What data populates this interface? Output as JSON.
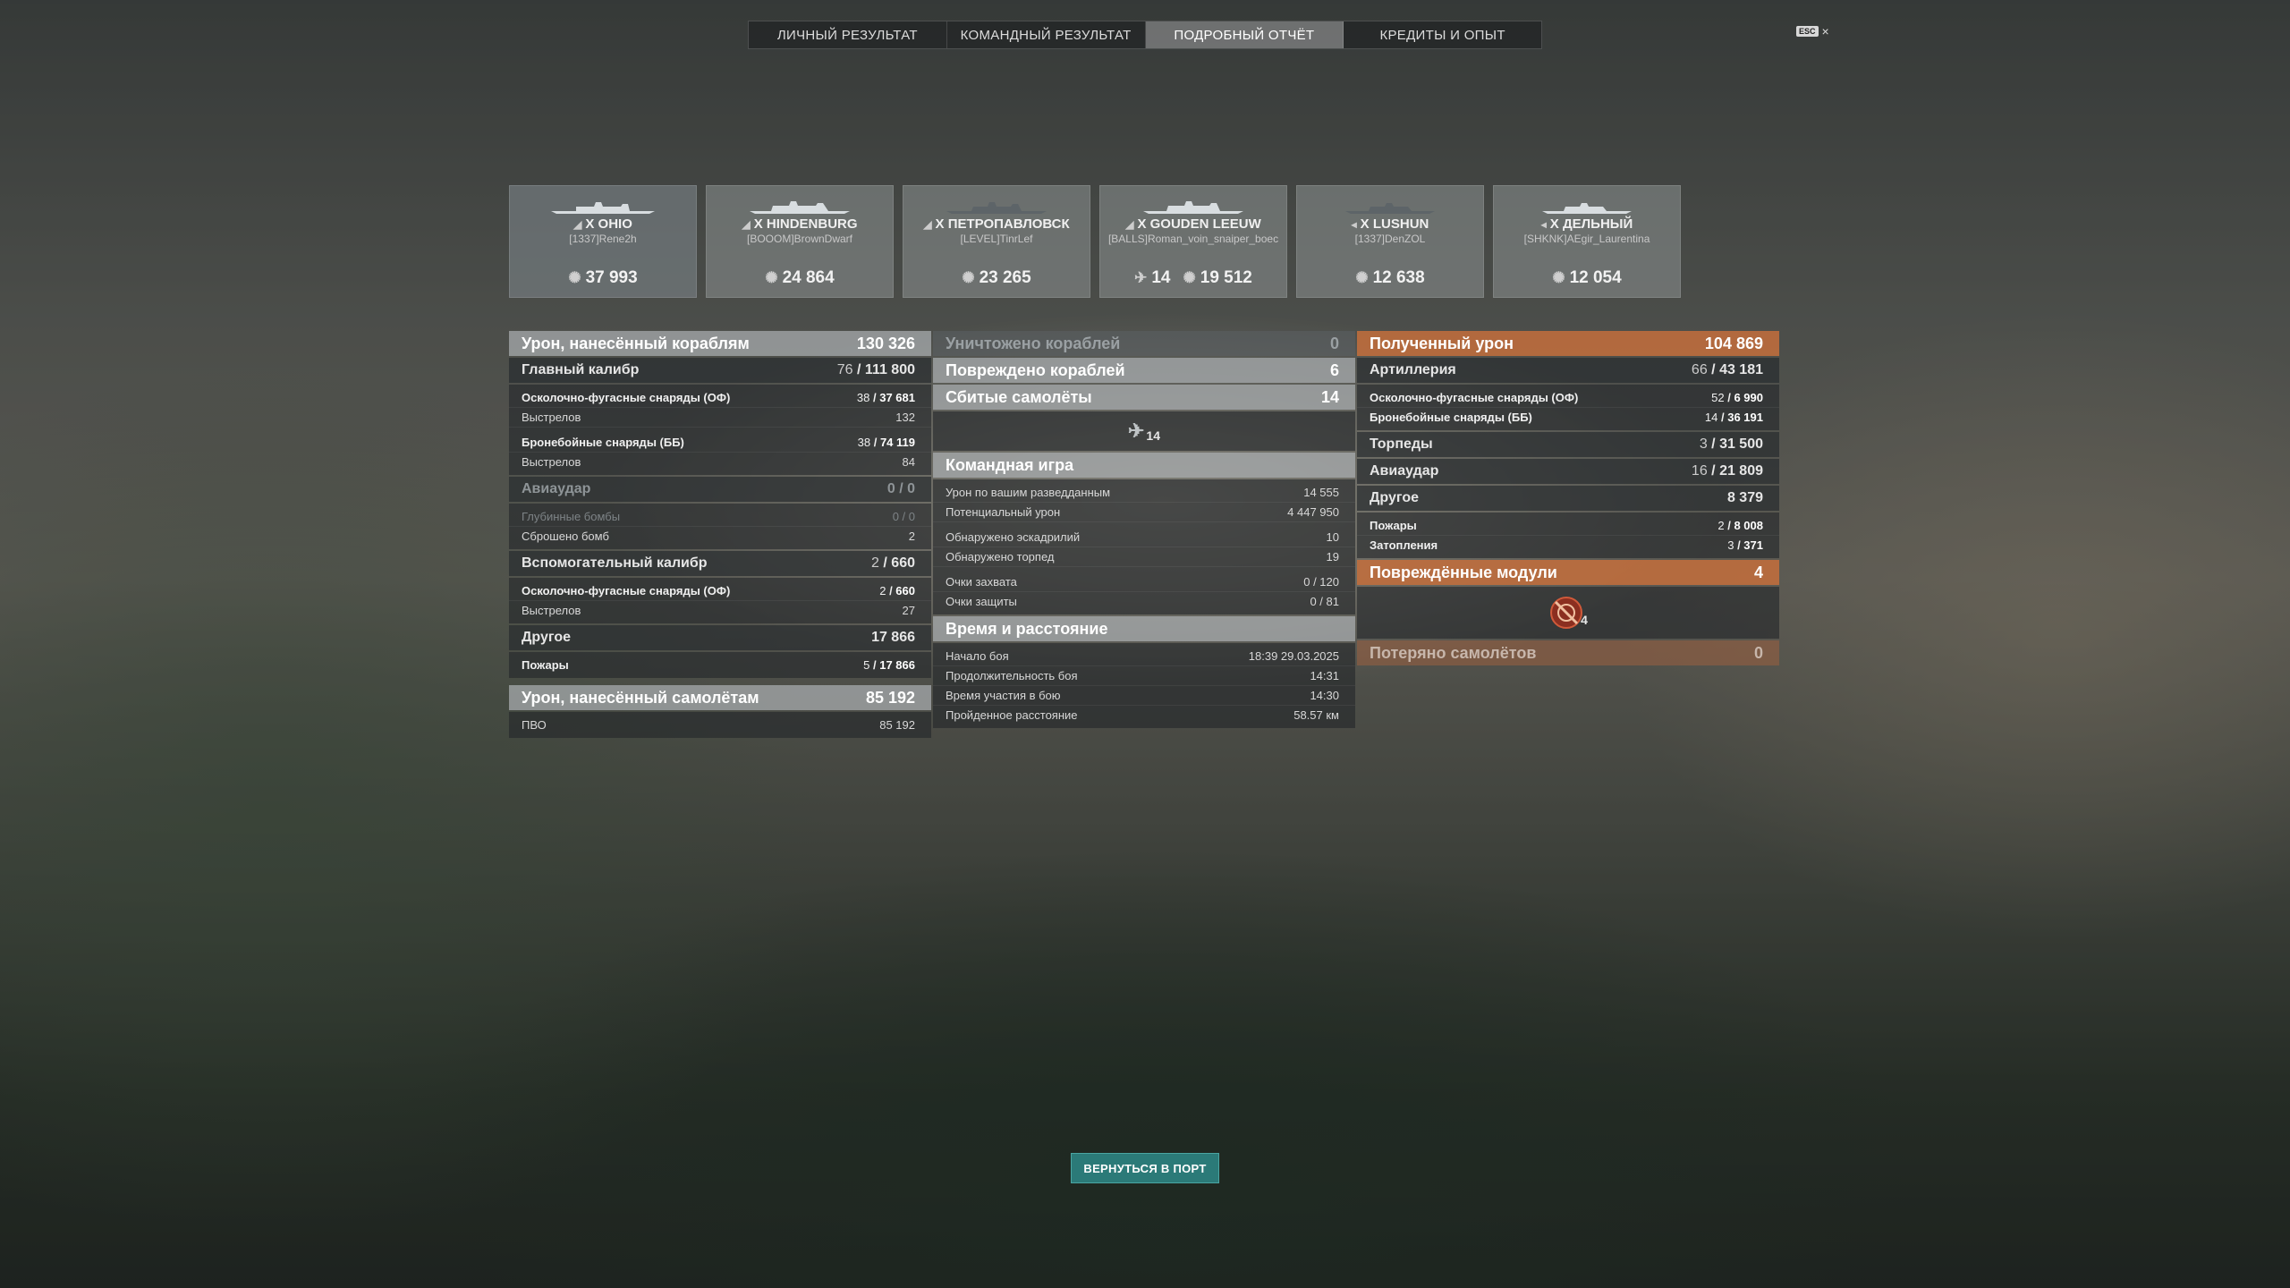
{
  "tabs": [
    "ЛИЧНЫЙ РЕЗУЛЬТАТ",
    "КОМАНДНЫЙ РЕЗУЛЬТАТ",
    "ПОДРОБНЫЙ ОТЧЁТ",
    "КРЕДИТЫ И ОПЫТ"
  ],
  "active_tab": "ПОДРОБНЫЙ ОТЧЁТ",
  "esc": {
    "key": "ESC",
    "close": "×"
  },
  "ships": [
    {
      "tier": "X",
      "name": "OHIO",
      "player": "[1337]Rene2h",
      "damage": "37 993"
    },
    {
      "tier": "X",
      "name": "HINDENBURG",
      "player": "[BOOOM]BrownDwarf",
      "damage": "24 864"
    },
    {
      "tier": "X",
      "name": "ПЕТРОПАВЛОВСК",
      "player": "[LEVEL]TinrLef",
      "damage": "23 265"
    },
    {
      "tier": "X",
      "name": "GOUDEN LEEUW",
      "player": "[BALLS]Roman_voin_snaiper_boec",
      "planes": "14",
      "damage": "19 512"
    },
    {
      "tier": "X",
      "name": "LUSHUN",
      "player": "[1337]DenZOL",
      "damage": "12 638"
    },
    {
      "tier": "X",
      "name": "ДЕЛЬНЫЙ",
      "player": "[SHKNK]AEgir_Laurentina",
      "damage": "12 054"
    }
  ],
  "col1": {
    "dmg_ships": {
      "label": "Урон, нанесённый кораблям",
      "value": "130 326"
    },
    "main": {
      "label": "Главный калибр",
      "hits": "76",
      "value": "111 800"
    },
    "he": {
      "label": "Осколочно-фугасные снаряды (ОФ)",
      "hits": "38",
      "value": "37 681"
    },
    "he_shots": {
      "label": "Выстрелов",
      "value": "132"
    },
    "ap": {
      "label": "Бронебойные снаряды (ББ)",
      "hits": "38",
      "value": "74 119"
    },
    "ap_shots": {
      "label": "Выстрелов",
      "value": "84"
    },
    "air": {
      "label": "Авиаудар",
      "value": "0 / 0"
    },
    "depth": {
      "label": "Глубинные бомбы",
      "value": "0 / 0"
    },
    "bombs": {
      "label": "Сброшено бомб",
      "value": "2"
    },
    "secondary": {
      "label": "Вспомогательный калибр",
      "hits": "2",
      "value": "660"
    },
    "sec_he": {
      "label": "Осколочно-фугасные снаряды (ОФ)",
      "hits": "2",
      "value": "660"
    },
    "sec_shots": {
      "label": "Выстрелов",
      "value": "27"
    },
    "other": {
      "label": "Другое",
      "value": "17 866"
    },
    "fires": {
      "label": "Пожары",
      "hits": "5",
      "value": "17 866"
    },
    "dmg_planes": {
      "label": "Урон, нанесённый самолётам",
      "value": "85 192"
    },
    "aa": {
      "label": "ПВО",
      "value": "85 192"
    }
  },
  "col2": {
    "destroyed": {
      "label": "Уничтожено кораблей",
      "value": "0"
    },
    "damaged": {
      "label": "Повреждено кораблей",
      "value": "6"
    },
    "planes": {
      "label": "Сбитые самолёты",
      "value": "14"
    },
    "planes_icon_count": "14",
    "team": {
      "label": "Командная игра"
    },
    "spotting": {
      "label": "Урон по вашим разведданным",
      "value": "14 555"
    },
    "potential": {
      "label": "Потенциальный урон",
      "value": "4 447 950"
    },
    "squadrons": {
      "label": "Обнаружено эскадрилий",
      "value": "10"
    },
    "torpedoes": {
      "label": "Обнаружено торпед",
      "value": "19"
    },
    "capture": {
      "label": "Очки захвата",
      "value": "0 / 120"
    },
    "defense": {
      "label": "Очки защиты",
      "value": "0 / 81"
    },
    "time": {
      "label": "Время и расстояние"
    },
    "start": {
      "label": "Начало боя",
      "value": "18:39  29.03.2025"
    },
    "duration": {
      "label": "Продолжительность боя",
      "value": "14:31"
    },
    "participation": {
      "label": "Время участия в бою",
      "value": "14:30"
    },
    "distance": {
      "label": "Пройденное расстояние",
      "value": "58.57 км"
    }
  },
  "col3": {
    "received": {
      "label": "Полученный урон",
      "value": "104 869"
    },
    "artillery": {
      "label": "Артиллерия",
      "hits": "66",
      "value": "43 181"
    },
    "r_he": {
      "label": "Осколочно-фугасные снаряды (ОФ)",
      "hits": "52",
      "value": "6 990"
    },
    "r_ap": {
      "label": "Бронебойные снаряды (ББ)",
      "hits": "14",
      "value": "36 191"
    },
    "torps": {
      "label": "Торпеды",
      "hits": "3",
      "value": "31 500"
    },
    "air": {
      "label": "Авиаудар",
      "hits": "16",
      "value": "21 809"
    },
    "other": {
      "label": "Другое",
      "value": "8 379"
    },
    "fires": {
      "label": "Пожары",
      "hits": "2",
      "value": "8 008"
    },
    "floods": {
      "label": "Затопления",
      "hits": "3",
      "value": "371"
    },
    "modules": {
      "label": "Повреждённые модули",
      "value": "4"
    },
    "modules_icon_count": "4",
    "lost_planes": {
      "label": "Потеряно самолётов",
      "value": "0"
    }
  },
  "return_button": "ВЕРНУТЬСЯ В ПОРТ",
  "colors": {
    "accent_orange": "#c46e3c",
    "button_teal": "#2b7a78"
  }
}
